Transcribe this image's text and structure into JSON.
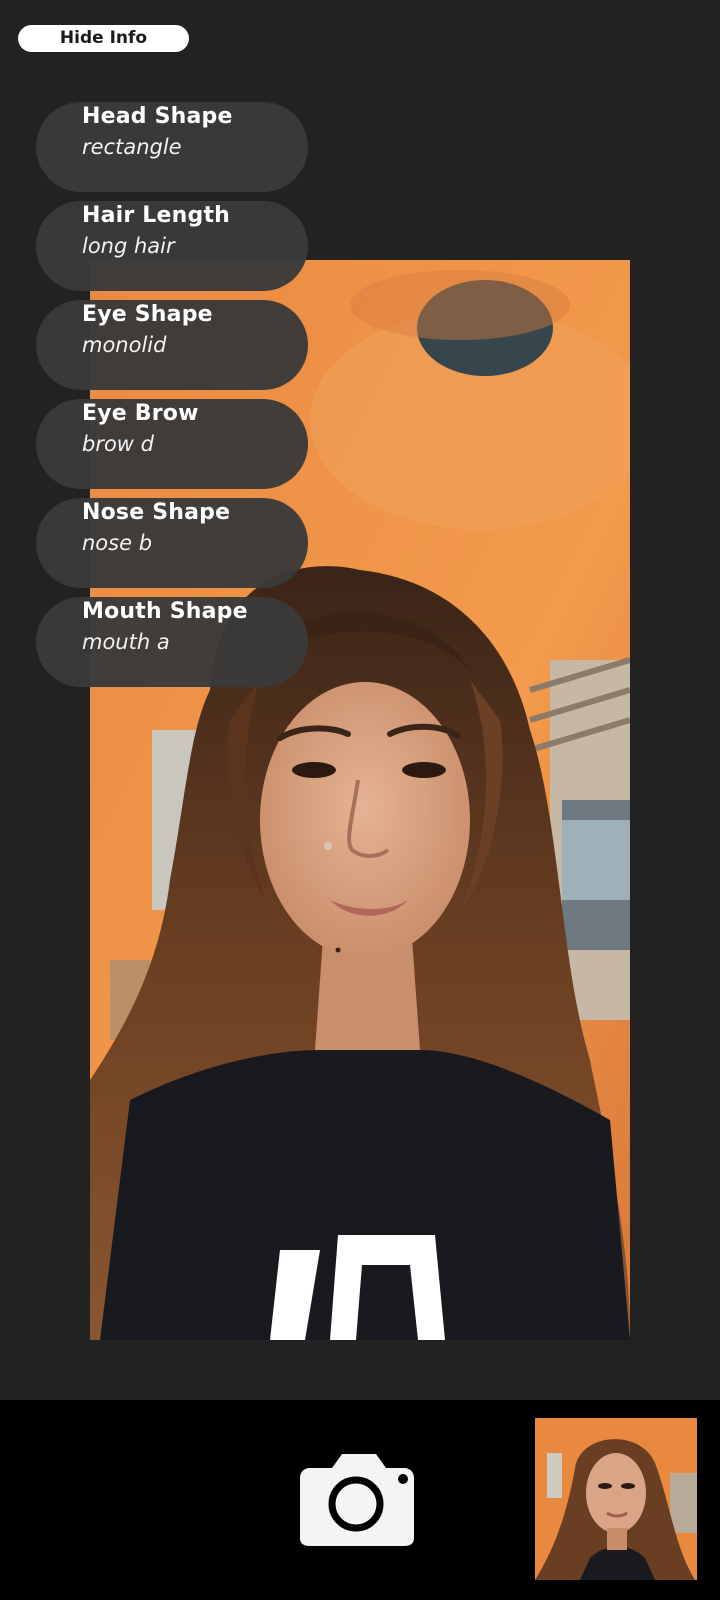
{
  "header": {
    "hide_info_label": "Hide Info"
  },
  "face_attributes": [
    {
      "title": "Head Shape",
      "value": "rectangle"
    },
    {
      "title": "Hair Length",
      "value": "long hair"
    },
    {
      "title": "Eye Shape",
      "value": "monolid"
    },
    {
      "title": "Eye Brow",
      "value": "brow d"
    },
    {
      "title": "Nose Shape",
      "value": "nose b"
    },
    {
      "title": "Mouth Shape",
      "value": "mouth a"
    }
  ],
  "camera": {
    "shutter_icon": "camera-icon",
    "thumbnail_icon": "last-photo-thumbnail"
  },
  "colors": {
    "background": "#222222",
    "card": "#3a3a3a",
    "bottom_bar": "#000000",
    "wall_orange": "#e8863f"
  }
}
